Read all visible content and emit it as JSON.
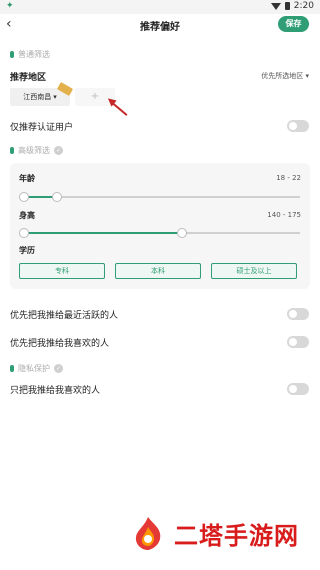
{
  "status": {
    "left_icon": "android-icon",
    "time": "2:20"
  },
  "header": {
    "title": "推荐偏好",
    "save_label": "保存",
    "back_icon": "‹"
  },
  "sections": {
    "normal": "普通筛选",
    "advanced": "高级筛选",
    "privacy": "隐私保护"
  },
  "region": {
    "label": "推荐地区",
    "right_link": "优先所选地区",
    "chip": "江西南昌",
    "chip_caret": "▾",
    "add": "+"
  },
  "verified": {
    "label": "仅推荐认证用户",
    "on": false
  },
  "advanced": {
    "age": {
      "label": "年龄",
      "value": "18 - 22",
      "min": 18,
      "max": 22
    },
    "height": {
      "label": "身高",
      "value": "140 - 175",
      "min": 140,
      "max": 175
    },
    "education": {
      "label": "学历",
      "options": [
        "专科",
        "本科",
        "硕士及以上"
      ]
    }
  },
  "prefs": [
    {
      "label": "优先把我推给最近活跃的人",
      "on": false
    },
    {
      "label": "优先把我推给我喜欢的人",
      "on": false
    }
  ],
  "privacy": {
    "label": "只把我推给我喜欢的人",
    "on": false
  },
  "watermark": {
    "text": "二塔手游网"
  },
  "colors": {
    "accent": "#2f9e74",
    "arrow": "#c62828",
    "watermark": "#d81b1b"
  }
}
